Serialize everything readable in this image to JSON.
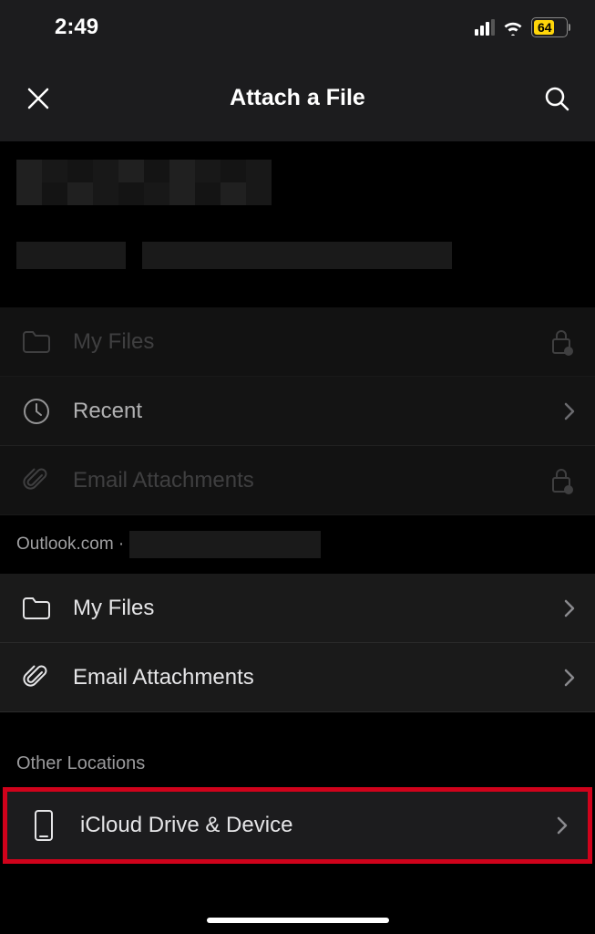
{
  "status": {
    "time": "2:49",
    "battery_percent": "64"
  },
  "header": {
    "title": "Attach a File"
  },
  "account1": {
    "items": [
      {
        "label": "My Files",
        "trailing": "lock"
      },
      {
        "label": "Recent",
        "trailing": "chevron"
      },
      {
        "label": "Email Attachments",
        "trailing": "lock"
      }
    ]
  },
  "account2": {
    "header_prefix": "Outlook.com · ",
    "items": [
      {
        "label": "My Files",
        "trailing": "chevron"
      },
      {
        "label": "Email Attachments",
        "trailing": "chevron"
      }
    ]
  },
  "other": {
    "header": "Other Locations",
    "items": [
      {
        "label": "iCloud Drive & Device",
        "trailing": "chevron"
      }
    ]
  }
}
